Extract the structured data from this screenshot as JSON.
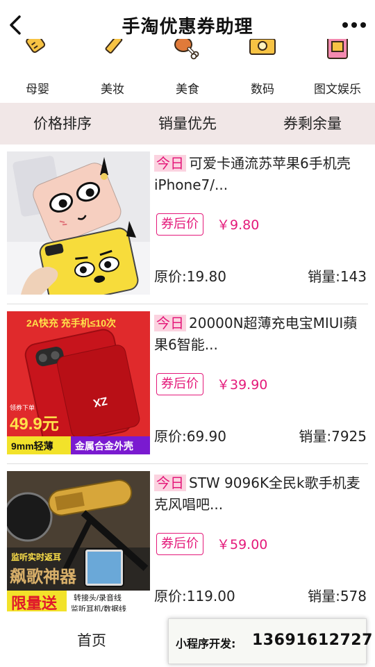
{
  "nav": {
    "title": "手淘优惠券助理"
  },
  "categories": [
    {
      "label": "母婴",
      "icon": "baby-bottle-icon"
    },
    {
      "label": "美妆",
      "icon": "lipstick-icon"
    },
    {
      "label": "美食",
      "icon": "drumstick-icon"
    },
    {
      "label": "数码",
      "icon": "camera-icon"
    },
    {
      "label": "图文娱乐",
      "icon": "book-icon"
    }
  ],
  "sort": [
    "价格排序",
    "销量优先",
    "券剩余量"
  ],
  "products": [
    {
      "tag": "今日",
      "title": "可爱卡通流苏苹果6手机壳iPhone7/...",
      "coupon_label": "券后价",
      "coupon_price": "￥9.80",
      "original_price": "原价:19.80",
      "sales": "销量:143"
    },
    {
      "tag": "今日",
      "title": "20000N超薄充电宝MIUI蘋果6智能...",
      "coupon_label": "券后价",
      "coupon_price": "￥39.90",
      "original_price": "原价:69.90",
      "sales": "销量:7925",
      "image_text": {
        "top": "2A快充 充手机≤10次",
        "badge_label": "领券下单",
        "badge_price": "49.9元",
        "left_bottom": "9mm轻薄",
        "right_bottom": "金属合金外壳"
      }
    },
    {
      "tag": "今日",
      "title": "STW 9096K全民k歌手机麦克风唱吧...",
      "coupon_label": "券后价",
      "coupon_price": "￥59.00",
      "original_price": "原价:119.00",
      "sales": "销量:578",
      "image_text": {
        "line1": "监听实时返耳",
        "line2": "飙歌神器",
        "gift": "限量送",
        "gift_items1": "转接头/录音线",
        "gift_items2": "监听耳机/数据线"
      }
    }
  ],
  "tabbar": {
    "home": "首页"
  },
  "promo": {
    "label": "小程序开发:",
    "phone": "13691612727"
  },
  "colors": {
    "accent": "#e4197a",
    "sort_bg": "#f1e7e7",
    "tag_bg": "#fbd3e0"
  }
}
